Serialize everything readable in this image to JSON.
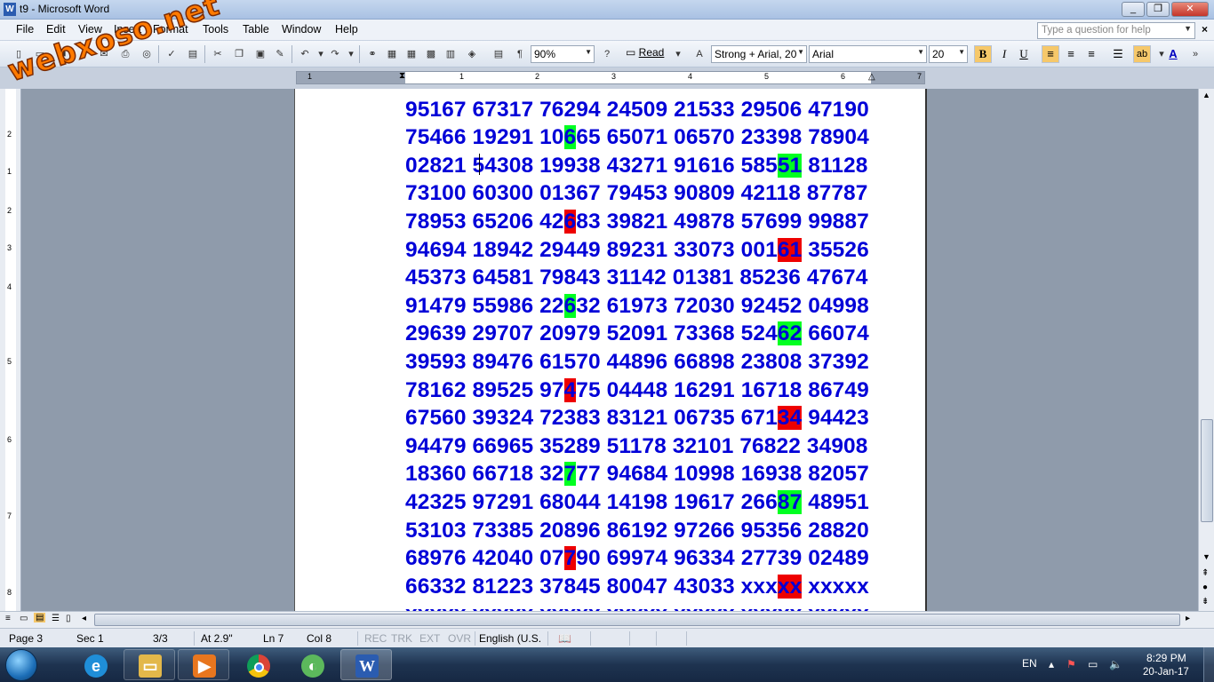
{
  "window": {
    "title": "t9 - Microsoft Word",
    "min": "_",
    "max": "❐",
    "close": "✕"
  },
  "menu": [
    "File",
    "Edit",
    "View",
    "Insert",
    "Format",
    "Tools",
    "Table",
    "Window",
    "Help"
  ],
  "help_box": {
    "placeholder": "Type a question for help"
  },
  "toolbar": {
    "zoom": "90%",
    "read_label": "Read",
    "style": "Strong + Arial, 20",
    "font": "Arial",
    "size": "20",
    "bold": "B",
    "italic": "I",
    "underline": "U",
    "font_color_label": "A",
    "highlight_label": "ab"
  },
  "hruler_numbers": [
    "1",
    "1",
    "2",
    "3",
    "4",
    "5",
    "6",
    "7"
  ],
  "vruler_numbers": [
    "2",
    "1",
    "2",
    "3",
    "4",
    "5",
    "6",
    "7",
    "8"
  ],
  "watermark": "webxoso.net",
  "document": {
    "rows": [
      [
        {
          "t": "95167 67317 76294 24509 21533 29506 47190",
          "h": ""
        }
      ],
      [
        {
          "t": "75466 19291 10",
          "h": ""
        },
        {
          "t": "6",
          "h": "green"
        },
        {
          "t": "65 65071 06570 23398 78904",
          "h": ""
        }
      ],
      [
        {
          "t": "02821 54308 19938 43271 91616 585",
          "h": ""
        },
        {
          "t": "51",
          "h": "green"
        },
        {
          "t": " 81128",
          "h": ""
        }
      ],
      [
        {
          "t": "73100 60300 01367 79453 90809 42118 87787",
          "h": ""
        }
      ],
      [
        {
          "t": "78953 65206 42",
          "h": ""
        },
        {
          "t": "6",
          "h": "red"
        },
        {
          "t": "83 39821 49878 57699 99887",
          "h": ""
        }
      ],
      [
        {
          "t": "94694 18942 29449 89231 33073 001",
          "h": ""
        },
        {
          "t": "61",
          "h": "red"
        },
        {
          "t": " 35526",
          "h": ""
        }
      ],
      [
        {
          "t": "45373 64581 79843 31142 01381 85236 47674",
          "h": ""
        }
      ],
      [
        {
          "t": "91479 55986 22",
          "h": ""
        },
        {
          "t": "6",
          "h": "green"
        },
        {
          "t": "32 61973 72030 92452 04998",
          "h": ""
        }
      ],
      [
        {
          "t": "29639 29707 20979 52091 73368 524",
          "h": ""
        },
        {
          "t": "62",
          "h": "green"
        },
        {
          "t": " 66074",
          "h": ""
        }
      ],
      [
        {
          "t": "39593 89476 61570 44896 66898 23808 37392",
          "h": ""
        }
      ],
      [
        {
          "t": "78162 89525 97",
          "h": ""
        },
        {
          "t": "4",
          "h": "red"
        },
        {
          "t": "75 04448 16291 16718 86749",
          "h": ""
        }
      ],
      [
        {
          "t": "67560 39324 72383 83121 06735 671",
          "h": ""
        },
        {
          "t": "34",
          "h": "red"
        },
        {
          "t": " 94423",
          "h": ""
        }
      ],
      [
        {
          "t": "94479 66965 35289 51178 32101 76822 34908",
          "h": ""
        }
      ],
      [
        {
          "t": "18360 66718 32",
          "h": ""
        },
        {
          "t": "7",
          "h": "green"
        },
        {
          "t": "77 94684 10998 16938 82057",
          "h": ""
        }
      ],
      [
        {
          "t": "42325 97291 68044 14198 19617 266",
          "h": ""
        },
        {
          "t": "87",
          "h": "green"
        },
        {
          "t": " 48951",
          "h": ""
        }
      ],
      [
        {
          "t": "53103 73385 20896 86192 97266 95356 28820",
          "h": ""
        }
      ],
      [
        {
          "t": "68976 42040 07",
          "h": ""
        },
        {
          "t": "7",
          "h": "red"
        },
        {
          "t": "90 69974 96334 27739 02489",
          "h": ""
        }
      ],
      [
        {
          "t": "66332 81223 37845 80047 43033 xxx",
          "h": ""
        },
        {
          "t": "xx",
          "h": "red"
        },
        {
          "t": " xxxxx",
          "h": ""
        }
      ],
      [
        {
          "t": "xxxxx xxxxx xxxxx xxxxx xxxxx xxxxx xxxxx",
          "h": ""
        }
      ]
    ]
  },
  "status": {
    "page": "Page 3",
    "sec": "Sec 1",
    "pages": "3/3",
    "at": "At 2.9\"",
    "ln": "Ln 7",
    "col": "Col 8",
    "rec": "REC",
    "trk": "TRK",
    "ext": "EXT",
    "ovr": "OVR",
    "lang": "English (U.S."
  },
  "taskbar": {
    "apps": [
      "explorer",
      "internet-explorer",
      "file-manager",
      "media-player",
      "chrome",
      "coccoc",
      "word"
    ],
    "lang": "EN",
    "time": "8:29 PM",
    "date": "20-Jan-17"
  },
  "colors": {
    "text_blue": "#0000d8",
    "hl_green": "#00ff21",
    "hl_red": "#ee0000"
  }
}
